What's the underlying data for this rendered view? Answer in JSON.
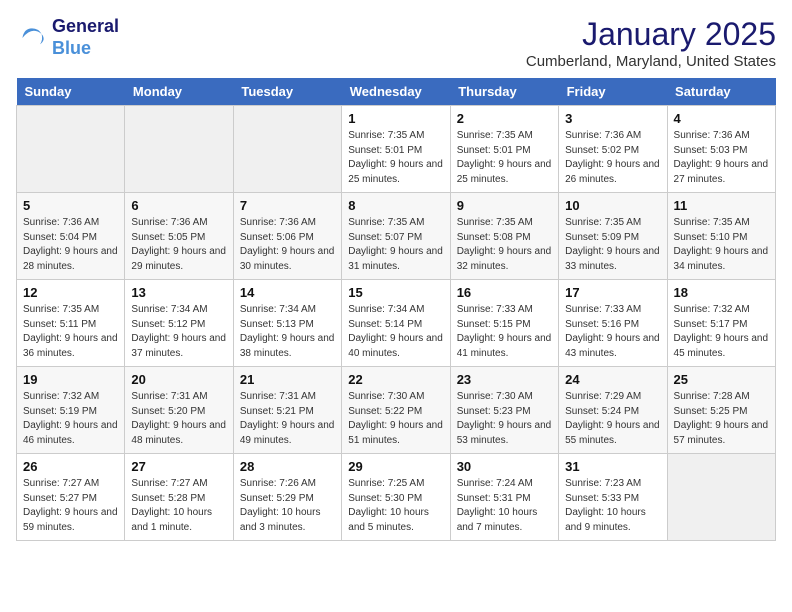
{
  "logo": {
    "line1": "General",
    "line2": "Blue"
  },
  "title": "January 2025",
  "location": "Cumberland, Maryland, United States",
  "weekdays": [
    "Sunday",
    "Monday",
    "Tuesday",
    "Wednesday",
    "Thursday",
    "Friday",
    "Saturday"
  ],
  "weeks": [
    [
      {
        "day": "",
        "empty": true
      },
      {
        "day": "",
        "empty": true
      },
      {
        "day": "",
        "empty": true
      },
      {
        "day": "1",
        "sunrise": "Sunrise: 7:35 AM",
        "sunset": "Sunset: 5:01 PM",
        "daylight": "Daylight: 9 hours and 25 minutes."
      },
      {
        "day": "2",
        "sunrise": "Sunrise: 7:35 AM",
        "sunset": "Sunset: 5:01 PM",
        "daylight": "Daylight: 9 hours and 25 minutes."
      },
      {
        "day": "3",
        "sunrise": "Sunrise: 7:36 AM",
        "sunset": "Sunset: 5:02 PM",
        "daylight": "Daylight: 9 hours and 26 minutes."
      },
      {
        "day": "4",
        "sunrise": "Sunrise: 7:36 AM",
        "sunset": "Sunset: 5:03 PM",
        "daylight": "Daylight: 9 hours and 27 minutes."
      }
    ],
    [
      {
        "day": "5",
        "sunrise": "Sunrise: 7:36 AM",
        "sunset": "Sunset: 5:04 PM",
        "daylight": "Daylight: 9 hours and 28 minutes."
      },
      {
        "day": "6",
        "sunrise": "Sunrise: 7:36 AM",
        "sunset": "Sunset: 5:05 PM",
        "daylight": "Daylight: 9 hours and 29 minutes."
      },
      {
        "day": "7",
        "sunrise": "Sunrise: 7:36 AM",
        "sunset": "Sunset: 5:06 PM",
        "daylight": "Daylight: 9 hours and 30 minutes."
      },
      {
        "day": "8",
        "sunrise": "Sunrise: 7:35 AM",
        "sunset": "Sunset: 5:07 PM",
        "daylight": "Daylight: 9 hours and 31 minutes."
      },
      {
        "day": "9",
        "sunrise": "Sunrise: 7:35 AM",
        "sunset": "Sunset: 5:08 PM",
        "daylight": "Daylight: 9 hours and 32 minutes."
      },
      {
        "day": "10",
        "sunrise": "Sunrise: 7:35 AM",
        "sunset": "Sunset: 5:09 PM",
        "daylight": "Daylight: 9 hours and 33 minutes."
      },
      {
        "day": "11",
        "sunrise": "Sunrise: 7:35 AM",
        "sunset": "Sunset: 5:10 PM",
        "daylight": "Daylight: 9 hours and 34 minutes."
      }
    ],
    [
      {
        "day": "12",
        "sunrise": "Sunrise: 7:35 AM",
        "sunset": "Sunset: 5:11 PM",
        "daylight": "Daylight: 9 hours and 36 minutes."
      },
      {
        "day": "13",
        "sunrise": "Sunrise: 7:34 AM",
        "sunset": "Sunset: 5:12 PM",
        "daylight": "Daylight: 9 hours and 37 minutes."
      },
      {
        "day": "14",
        "sunrise": "Sunrise: 7:34 AM",
        "sunset": "Sunset: 5:13 PM",
        "daylight": "Daylight: 9 hours and 38 minutes."
      },
      {
        "day": "15",
        "sunrise": "Sunrise: 7:34 AM",
        "sunset": "Sunset: 5:14 PM",
        "daylight": "Daylight: 9 hours and 40 minutes."
      },
      {
        "day": "16",
        "sunrise": "Sunrise: 7:33 AM",
        "sunset": "Sunset: 5:15 PM",
        "daylight": "Daylight: 9 hours and 41 minutes."
      },
      {
        "day": "17",
        "sunrise": "Sunrise: 7:33 AM",
        "sunset": "Sunset: 5:16 PM",
        "daylight": "Daylight: 9 hours and 43 minutes."
      },
      {
        "day": "18",
        "sunrise": "Sunrise: 7:32 AM",
        "sunset": "Sunset: 5:17 PM",
        "daylight": "Daylight: 9 hours and 45 minutes."
      }
    ],
    [
      {
        "day": "19",
        "sunrise": "Sunrise: 7:32 AM",
        "sunset": "Sunset: 5:19 PM",
        "daylight": "Daylight: 9 hours and 46 minutes."
      },
      {
        "day": "20",
        "sunrise": "Sunrise: 7:31 AM",
        "sunset": "Sunset: 5:20 PM",
        "daylight": "Daylight: 9 hours and 48 minutes."
      },
      {
        "day": "21",
        "sunrise": "Sunrise: 7:31 AM",
        "sunset": "Sunset: 5:21 PM",
        "daylight": "Daylight: 9 hours and 49 minutes."
      },
      {
        "day": "22",
        "sunrise": "Sunrise: 7:30 AM",
        "sunset": "Sunset: 5:22 PM",
        "daylight": "Daylight: 9 hours and 51 minutes."
      },
      {
        "day": "23",
        "sunrise": "Sunrise: 7:30 AM",
        "sunset": "Sunset: 5:23 PM",
        "daylight": "Daylight: 9 hours and 53 minutes."
      },
      {
        "day": "24",
        "sunrise": "Sunrise: 7:29 AM",
        "sunset": "Sunset: 5:24 PM",
        "daylight": "Daylight: 9 hours and 55 minutes."
      },
      {
        "day": "25",
        "sunrise": "Sunrise: 7:28 AM",
        "sunset": "Sunset: 5:25 PM",
        "daylight": "Daylight: 9 hours and 57 minutes."
      }
    ],
    [
      {
        "day": "26",
        "sunrise": "Sunrise: 7:27 AM",
        "sunset": "Sunset: 5:27 PM",
        "daylight": "Daylight: 9 hours and 59 minutes."
      },
      {
        "day": "27",
        "sunrise": "Sunrise: 7:27 AM",
        "sunset": "Sunset: 5:28 PM",
        "daylight": "Daylight: 10 hours and 1 minute."
      },
      {
        "day": "28",
        "sunrise": "Sunrise: 7:26 AM",
        "sunset": "Sunset: 5:29 PM",
        "daylight": "Daylight: 10 hours and 3 minutes."
      },
      {
        "day": "29",
        "sunrise": "Sunrise: 7:25 AM",
        "sunset": "Sunset: 5:30 PM",
        "daylight": "Daylight: 10 hours and 5 minutes."
      },
      {
        "day": "30",
        "sunrise": "Sunrise: 7:24 AM",
        "sunset": "Sunset: 5:31 PM",
        "daylight": "Daylight: 10 hours and 7 minutes."
      },
      {
        "day": "31",
        "sunrise": "Sunrise: 7:23 AM",
        "sunset": "Sunset: 5:33 PM",
        "daylight": "Daylight: 10 hours and 9 minutes."
      },
      {
        "day": "",
        "empty": true
      }
    ]
  ]
}
